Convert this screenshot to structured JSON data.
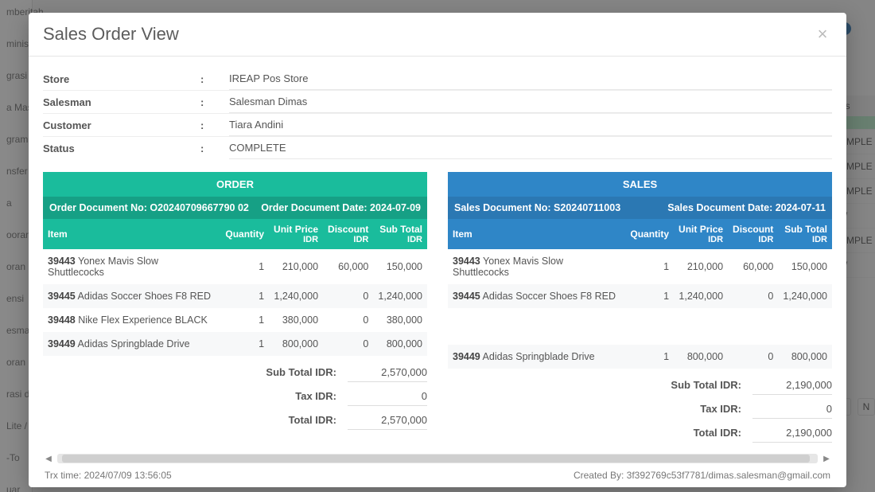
{
  "modal": {
    "title": "Sales Order View"
  },
  "info": {
    "store": {
      "label": "Store",
      "value": "IREAP Pos Store"
    },
    "salesman": {
      "label": "Salesman",
      "value": "Salesman Dimas"
    },
    "customer": {
      "label": "Customer",
      "value": "Tiara Andini"
    },
    "status": {
      "label": "Status",
      "value": "COMPLETE"
    }
  },
  "columns": {
    "item": "Item",
    "quantity": "Quantity",
    "unit_price": "Unit Price",
    "discount": "Discount",
    "sub_total": "Sub Total",
    "currency_sub": "IDR"
  },
  "order": {
    "title": "ORDER",
    "doc_no_label": "Order Document No:",
    "doc_no": "O20240709667790 02",
    "doc_date_label": "Order Document Date:",
    "doc_date": "2024-07-09",
    "items": [
      {
        "sku": "39443",
        "name": "Yonex Mavis Slow Shuttlecocks",
        "qty": "1",
        "price": "210,000",
        "discount": "60,000",
        "subtotal": "150,000"
      },
      {
        "sku": "39445",
        "name": "Adidas Soccer Shoes F8 RED",
        "qty": "1",
        "price": "1,240,000",
        "discount": "0",
        "subtotal": "1,240,000"
      },
      {
        "sku": "39448",
        "name": "Nike Flex Experience BLACK",
        "qty": "1",
        "price": "380,000",
        "discount": "0",
        "subtotal": "380,000"
      },
      {
        "sku": "39449",
        "name": "Adidas Springblade Drive",
        "qty": "1",
        "price": "800,000",
        "discount": "0",
        "subtotal": "800,000"
      }
    ],
    "totals": {
      "sub_total_label": "Sub Total IDR:",
      "sub_total": "2,570,000",
      "tax_label": "Tax IDR:",
      "tax": "0",
      "total_label": "Total IDR:",
      "total": "2,570,000"
    }
  },
  "sales": {
    "title": "SALES",
    "doc_no_label": "Sales Document No:",
    "doc_no": "S20240711003",
    "doc_date_label": "Sales Document Date:",
    "doc_date": "2024-07-11",
    "items": [
      {
        "sku": "39443",
        "name": "Yonex Mavis Slow Shuttlecocks",
        "qty": "1",
        "price": "210,000",
        "discount": "60,000",
        "subtotal": "150,000"
      },
      {
        "sku": "39445",
        "name": "Adidas Soccer Shoes F8 RED",
        "qty": "1",
        "price": "1,240,000",
        "discount": "0",
        "subtotal": "1,240,000"
      },
      {
        "sku": "",
        "name": "",
        "qty": "",
        "price": "",
        "discount": "",
        "subtotal": ""
      },
      {
        "sku": "39449",
        "name": "Adidas Springblade Drive",
        "qty": "1",
        "price": "800,000",
        "discount": "0",
        "subtotal": "800,000"
      }
    ],
    "totals": {
      "sub_total_label": "Sub Total IDR:",
      "sub_total": "2,190,000",
      "tax_label": "Tax IDR:",
      "tax": "0",
      "total_label": "Total IDR:",
      "total": "2,190,000"
    }
  },
  "footer": {
    "trx_time_label": "Trx time:",
    "trx_time": "2024/07/09 13:56:05",
    "created_by_label": "Created By:",
    "created_by": "3f392769c53f7781/dimas.salesman@gmail.com"
  },
  "bg": {
    "sidebar": [
      "mberitah",
      "ministras",
      "grasi",
      "a Master",
      "gram Lo",
      "nsfer Ba",
      "a",
      "ooran pe",
      "oran Inv",
      "ensi",
      "esman",
      "oran Fa",
      "rasi dar",
      "Lite / Ka",
      "-To",
      "uar"
    ],
    "status_header": "atus",
    "status_cells": [
      "",
      "COMPLE",
      "COMPLE",
      "COMPLE",
      "EW",
      "COMPLE",
      "EW"
    ],
    "pager": [
      "1",
      "N"
    ]
  }
}
